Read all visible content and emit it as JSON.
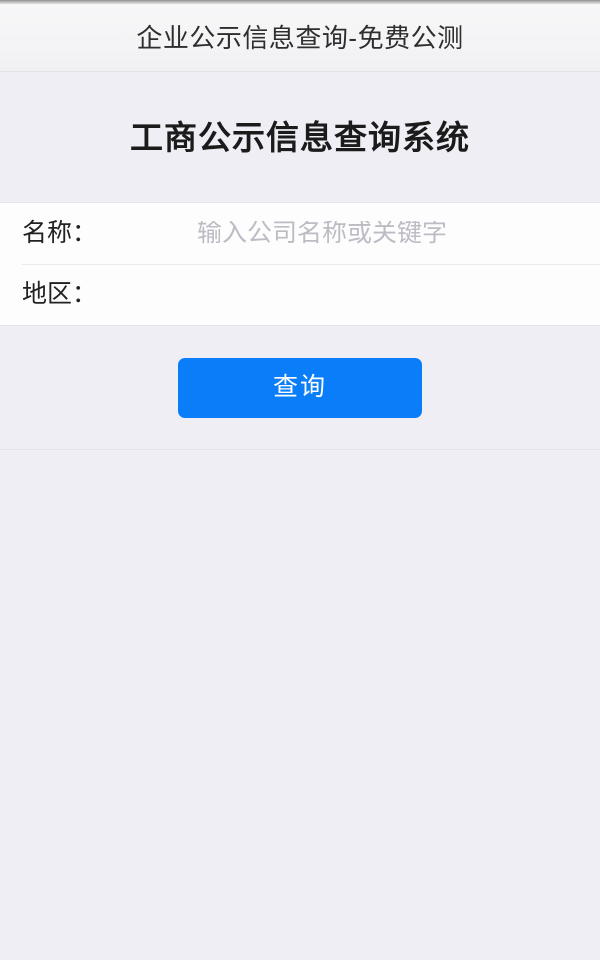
{
  "window": {
    "title": "企业公示信息查询-免费公测"
  },
  "page": {
    "heading": "工商公示信息查询系统"
  },
  "form": {
    "fields": [
      {
        "label": "名称：",
        "value": "",
        "placeholder": "输入公司名称或关键字",
        "name": "company-name"
      },
      {
        "label": "地区：",
        "value": "",
        "placeholder": "",
        "name": "region"
      }
    ]
  },
  "actions": {
    "submit_label": "查询"
  },
  "results": {
    "empty_text": ""
  },
  "colors": {
    "accent": "#0a7ef8",
    "page_background": "#eeeef4",
    "card_background": "#fdfdfe",
    "titlebar_text": "#2e2e2e",
    "heading_text": "#1b1b1b",
    "placeholder_text": "#bcbcc4",
    "divider": "#e9e9ef",
    "submit_text": "#ffffff"
  }
}
